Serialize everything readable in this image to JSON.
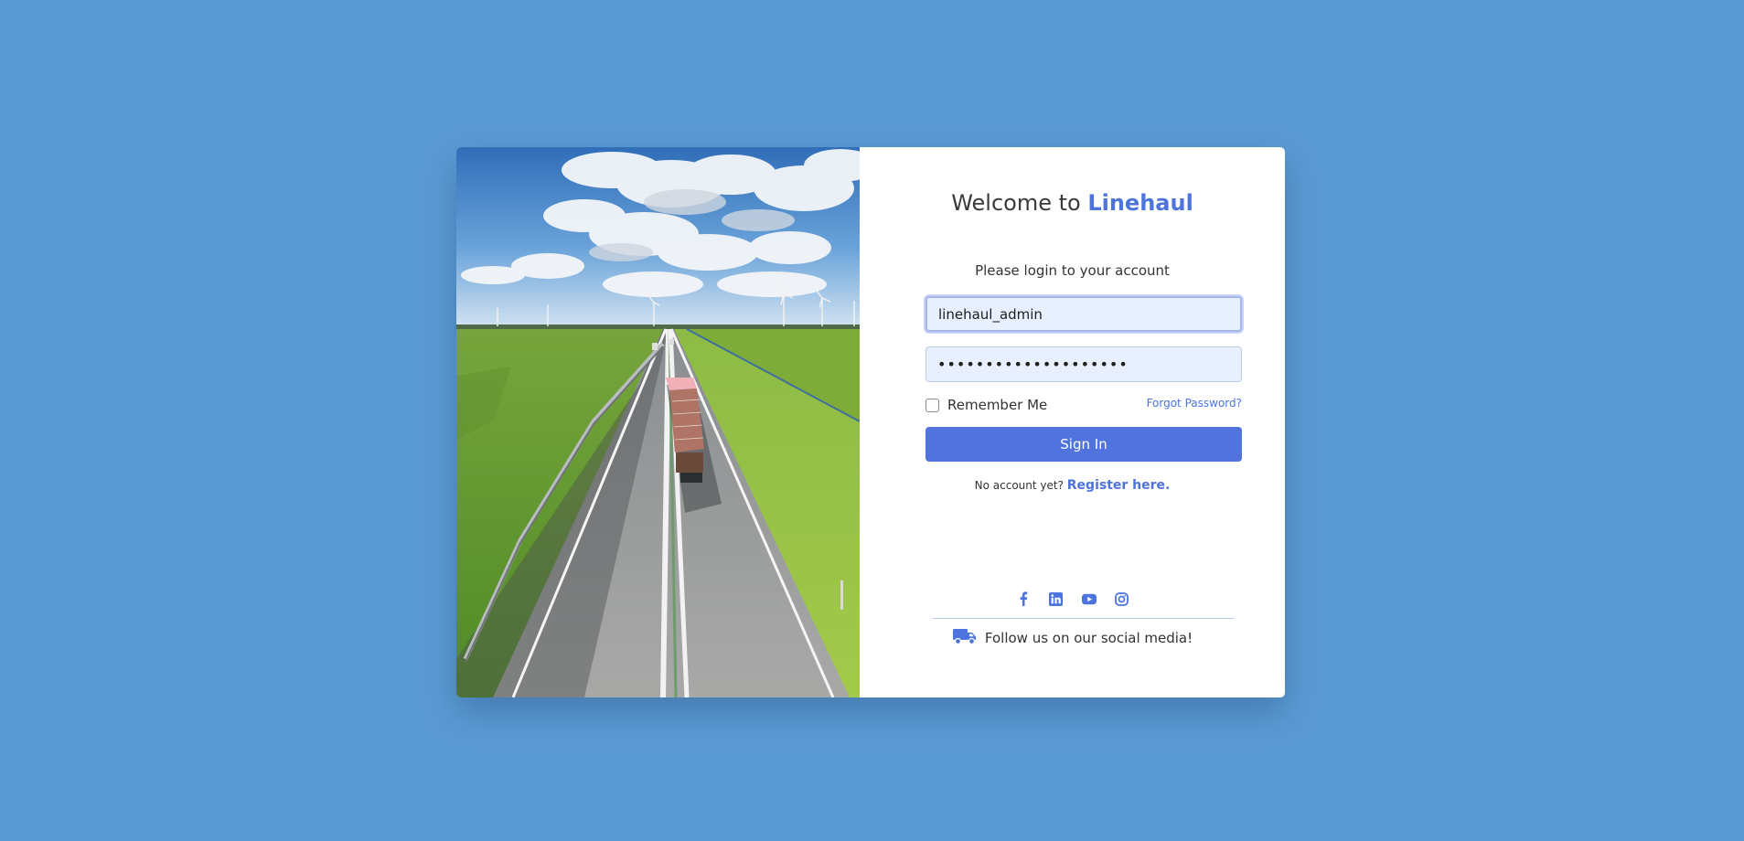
{
  "welcome": {
    "prefix": "Welcome to ",
    "brand": "Linehaul"
  },
  "login": {
    "subtitle": "Please login to your account",
    "username_value": "linehaul_admin",
    "password_value": "••••••••••••••••••••",
    "remember_label": "Remember Me",
    "remember_checked": false,
    "forgot_label": "Forgot Password?",
    "signin_label": "Sign In"
  },
  "register": {
    "prompt": "No account yet?",
    "link_label": "Register here."
  },
  "social": {
    "icons": [
      "facebook-icon",
      "linkedin-icon",
      "youtube-icon",
      "instagram-icon"
    ],
    "follow_text": "Follow us on our social media!"
  },
  "colors": {
    "page_background": "#5b9bd5",
    "accent": "#4d73dd",
    "input_fill": "#e8effe"
  }
}
